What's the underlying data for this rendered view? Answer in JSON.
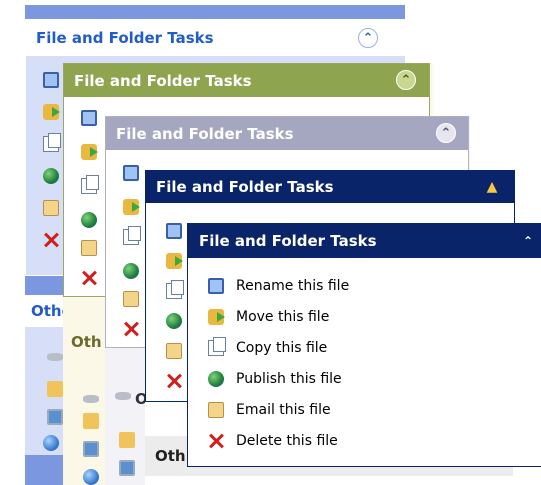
{
  "task_title": "File and Folder Tasks",
  "other_title_fragments": {
    "blue": "Other P",
    "olive": "Oth",
    "silver": "Oth",
    "navy": "Oth"
  },
  "tasks": [
    {
      "label": "Rename this file",
      "icon": "rename-icon"
    },
    {
      "label": "Move this file",
      "icon": "move-icon"
    },
    {
      "label": "Copy this file",
      "icon": "copy-icon"
    },
    {
      "label": "Publish this file",
      "icon": "publish-icon"
    },
    {
      "label": "Email this file",
      "icon": "email-icon"
    },
    {
      "label": "Delete this file",
      "icon": "delete-icon"
    }
  ],
  "themes": {
    "blue": {
      "header_bg": "#ffffff",
      "header_text": "#215dc6",
      "panel_bg": "#7b97e0"
    },
    "olive": {
      "header_bg": "#8ea44e",
      "header_text": "#ffffff"
    },
    "silver": {
      "header_bg": "#a5a6c0",
      "header_text": "#ffffff"
    },
    "navy": {
      "header_bg": "#0a246a",
      "header_text": "#ffffff"
    },
    "classic": {
      "header_bg": "#0a246a",
      "header_text": "#ffffff"
    }
  }
}
